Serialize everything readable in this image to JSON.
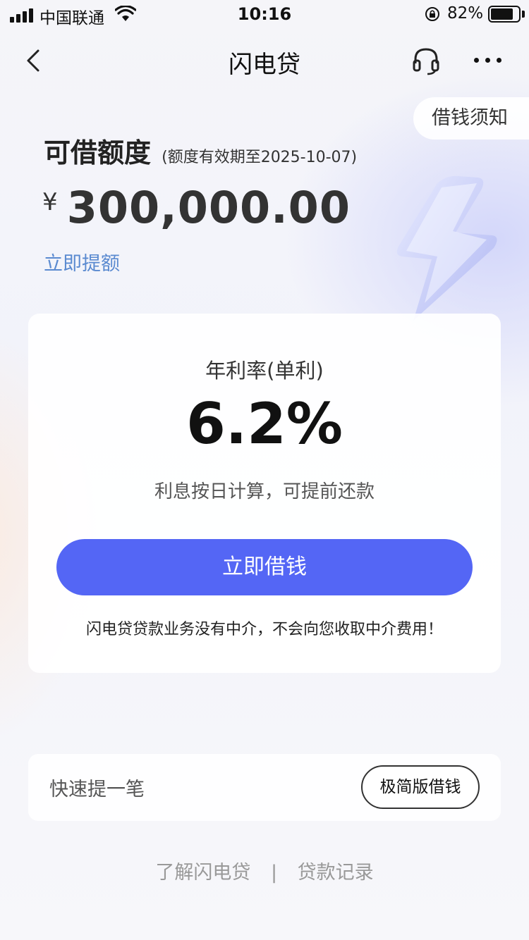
{
  "status_bar": {
    "carrier": "中国联通",
    "time": "10:16",
    "battery_percent": "82%",
    "battery_level": 0.82,
    "icons": [
      "signal-icon",
      "wifi-icon",
      "rotation-lock-icon",
      "battery-icon"
    ]
  },
  "nav": {
    "title": "闪电贷",
    "icons": [
      "back-arrow-icon",
      "headset-icon",
      "more-icon"
    ]
  },
  "notice_tab": {
    "label": "借钱须知"
  },
  "credit": {
    "title": "可借额度",
    "validity": "(额度有效期至2025-10-07)",
    "currency_symbol": "¥",
    "amount": "300,000.00",
    "raise_link": "立即提额"
  },
  "rate_card": {
    "label": "年利率(单利)",
    "rate": "6.2%",
    "note": "利息按日计算，可提前还款",
    "borrow_button": "立即借钱",
    "disclaimer": "闪电贷贷款业务没有中介，不会向您收取中介费用！"
  },
  "quick": {
    "label": "快速提一笔",
    "simple_button": "极简版借钱"
  },
  "footer": {
    "link1": "了解闪电贷",
    "separator": "|",
    "link2": "贷款记录"
  },
  "colors": {
    "accent": "#5466f5",
    "link": "#5a8ad0"
  }
}
